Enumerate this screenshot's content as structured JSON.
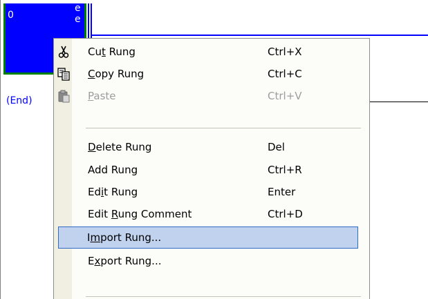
{
  "ladder": {
    "rung_number": "0",
    "instr_top": "e",
    "instr_bottom": "e",
    "end_label": "(End)"
  },
  "context_menu": {
    "items": [
      {
        "label_pre": "Cu",
        "mnemonic": "t",
        "label_post": " Rung",
        "accel": "Ctrl+X",
        "icon": "scissors-icon",
        "enabled": true
      },
      {
        "label_pre": "",
        "mnemonic": "C",
        "label_post": "opy Rung",
        "accel": "Ctrl+C",
        "icon": "copy-icon",
        "enabled": true
      },
      {
        "label_pre": "",
        "mnemonic": "P",
        "label_post": "aste",
        "accel": "Ctrl+V",
        "icon": "clipboard-icon",
        "enabled": false
      },
      {
        "label_pre": "",
        "mnemonic": "D",
        "label_post": "elete Rung",
        "accel": "Del",
        "enabled": true
      },
      {
        "label_pre": "Add Rung",
        "mnemonic": "",
        "label_post": "",
        "accel": "Ctrl+R",
        "enabled": true
      },
      {
        "label_pre": "Ed",
        "mnemonic": "i",
        "label_post": "t Rung",
        "accel": "Enter",
        "enabled": true
      },
      {
        "label_pre": "Edit ",
        "mnemonic": "R",
        "label_post": "ung Comment",
        "accel": "Ctrl+D",
        "enabled": true
      },
      {
        "label_pre": "I",
        "mnemonic": "m",
        "label_post": "port Rung...",
        "accel": "",
        "enabled": true,
        "highlighted": true
      },
      {
        "label_pre": "E",
        "mnemonic": "x",
        "label_post": "port Rung...",
        "accel": "",
        "enabled": true
      }
    ],
    "highlight_color": "#c1d2ee",
    "highlight_border": "#316ac5"
  }
}
